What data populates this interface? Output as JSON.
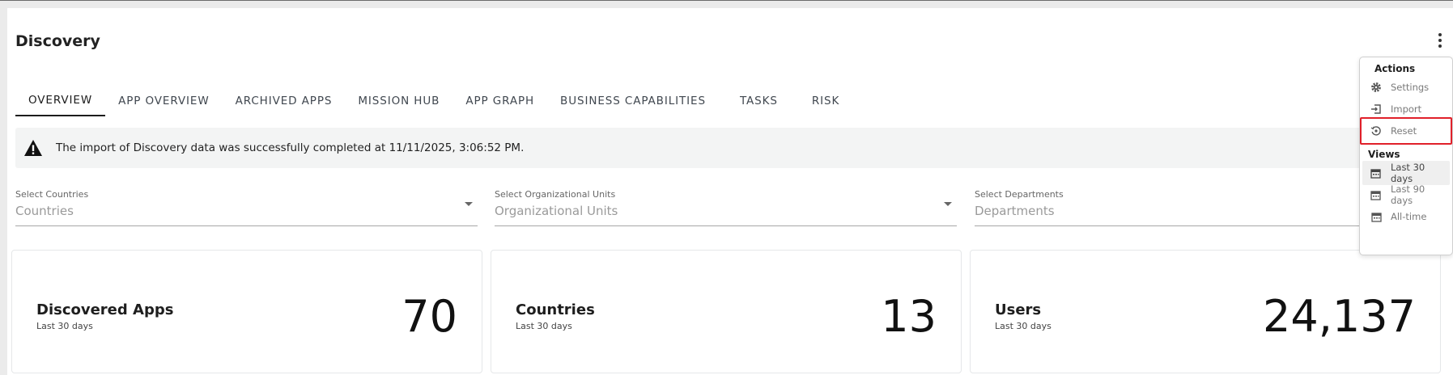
{
  "page": {
    "title": "Discovery"
  },
  "tabs": [
    {
      "label": "OVERVIEW",
      "active": true
    },
    {
      "label": "APP OVERVIEW"
    },
    {
      "label": "ARCHIVED APPS"
    },
    {
      "label": "MISSION HUB"
    },
    {
      "label": "APP GRAPH"
    },
    {
      "label": "BUSINESS CAPABILITIES"
    },
    {
      "label": "TASKS"
    },
    {
      "label": "RISK"
    }
  ],
  "alert": {
    "icon": "warning-icon",
    "message": "The import of Discovery data was successfully completed at 11/11/2025, 3:06:52 PM."
  },
  "filters": [
    {
      "label": "Select Countries",
      "placeholder": "Countries"
    },
    {
      "label": "Select Organizational Units",
      "placeholder": "Organizational Units"
    },
    {
      "label": "Select Departments",
      "placeholder": "Departments"
    }
  ],
  "cards": [
    {
      "title": "Discovered Apps",
      "subtitle": "Last 30 days",
      "value": "70"
    },
    {
      "title": "Countries",
      "subtitle": "Last 30 days",
      "value": "13"
    },
    {
      "title": "Users",
      "subtitle": "Last 30 days",
      "value": "24,137"
    }
  ],
  "menu": {
    "actions_heading": "Actions",
    "actions": [
      {
        "label": "Settings",
        "icon": "gear-icon"
      },
      {
        "label": "Import",
        "icon": "import-icon"
      },
      {
        "label": "Reset",
        "icon": "reset-icon",
        "outlined": true
      }
    ],
    "views_heading": "Views",
    "views": [
      {
        "label": "Last 30 days",
        "icon": "calendar-icon",
        "selected": true
      },
      {
        "label": "Last 90 days",
        "icon": "calendar-icon"
      },
      {
        "label": "All-time",
        "icon": "calendar-icon"
      }
    ]
  },
  "colors": {
    "highlight_outline": "#e0202a",
    "alert_bg": "#f3f4f4",
    "active_tab": "#1c1c1c"
  }
}
